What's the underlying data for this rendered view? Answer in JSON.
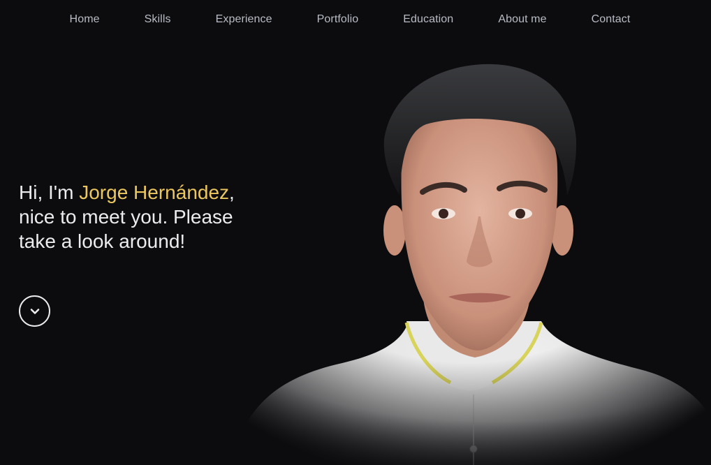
{
  "nav": {
    "items": [
      {
        "label": "Home"
      },
      {
        "label": "Skills"
      },
      {
        "label": "Experience"
      },
      {
        "label": "Portfolio"
      },
      {
        "label": "Education"
      },
      {
        "label": "About me"
      },
      {
        "label": "Contact"
      }
    ]
  },
  "hero": {
    "greeting_prefix": "Hi, I'm ",
    "name": "Jorge Hernández",
    "greeting_suffix": ", nice to meet you. Please take a look around!",
    "scroll_icon": "chevron-down-icon"
  },
  "portrait": {
    "subject": "profile-photo"
  },
  "colors": {
    "background": "#0c0c0f",
    "accent": "#ecc75e",
    "nav_text": "#b9bcc4",
    "hero_text": "#ececef"
  }
}
